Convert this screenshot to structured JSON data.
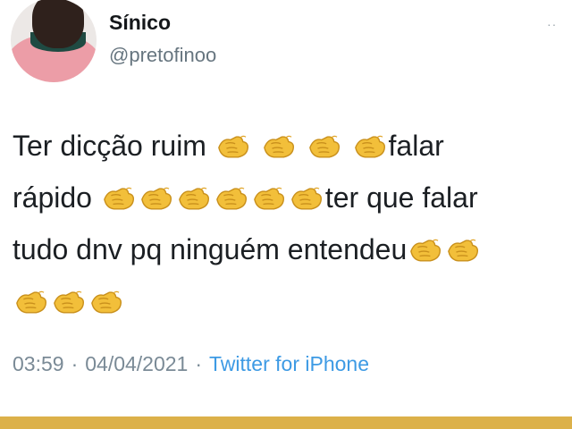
{
  "user": {
    "display_name": "Sínico",
    "handle": "@pretofinoo",
    "avatar_icon": "profile-photo"
  },
  "header": {
    "more_icon": "more-options-icon"
  },
  "tweet": {
    "text_segments": {
      "line1_a": "Ter dicção ruim",
      "line1_b": "falar",
      "line2_a": "rápido",
      "line2_b": "ter que falar",
      "line3_a": "tudo dnv pq ninguém entendeu"
    },
    "emoji_icon": "clapping-hands-emoji"
  },
  "meta": {
    "time": "03:59",
    "date": "04/04/2021",
    "separator": "·",
    "source": "Twitter for iPhone"
  },
  "colors": {
    "emoji_yellow": "#f2bf3a",
    "source_link": "#3d9ae4",
    "meta_gray": "#7a8a96",
    "bottom_bar": "#dcb14a"
  }
}
